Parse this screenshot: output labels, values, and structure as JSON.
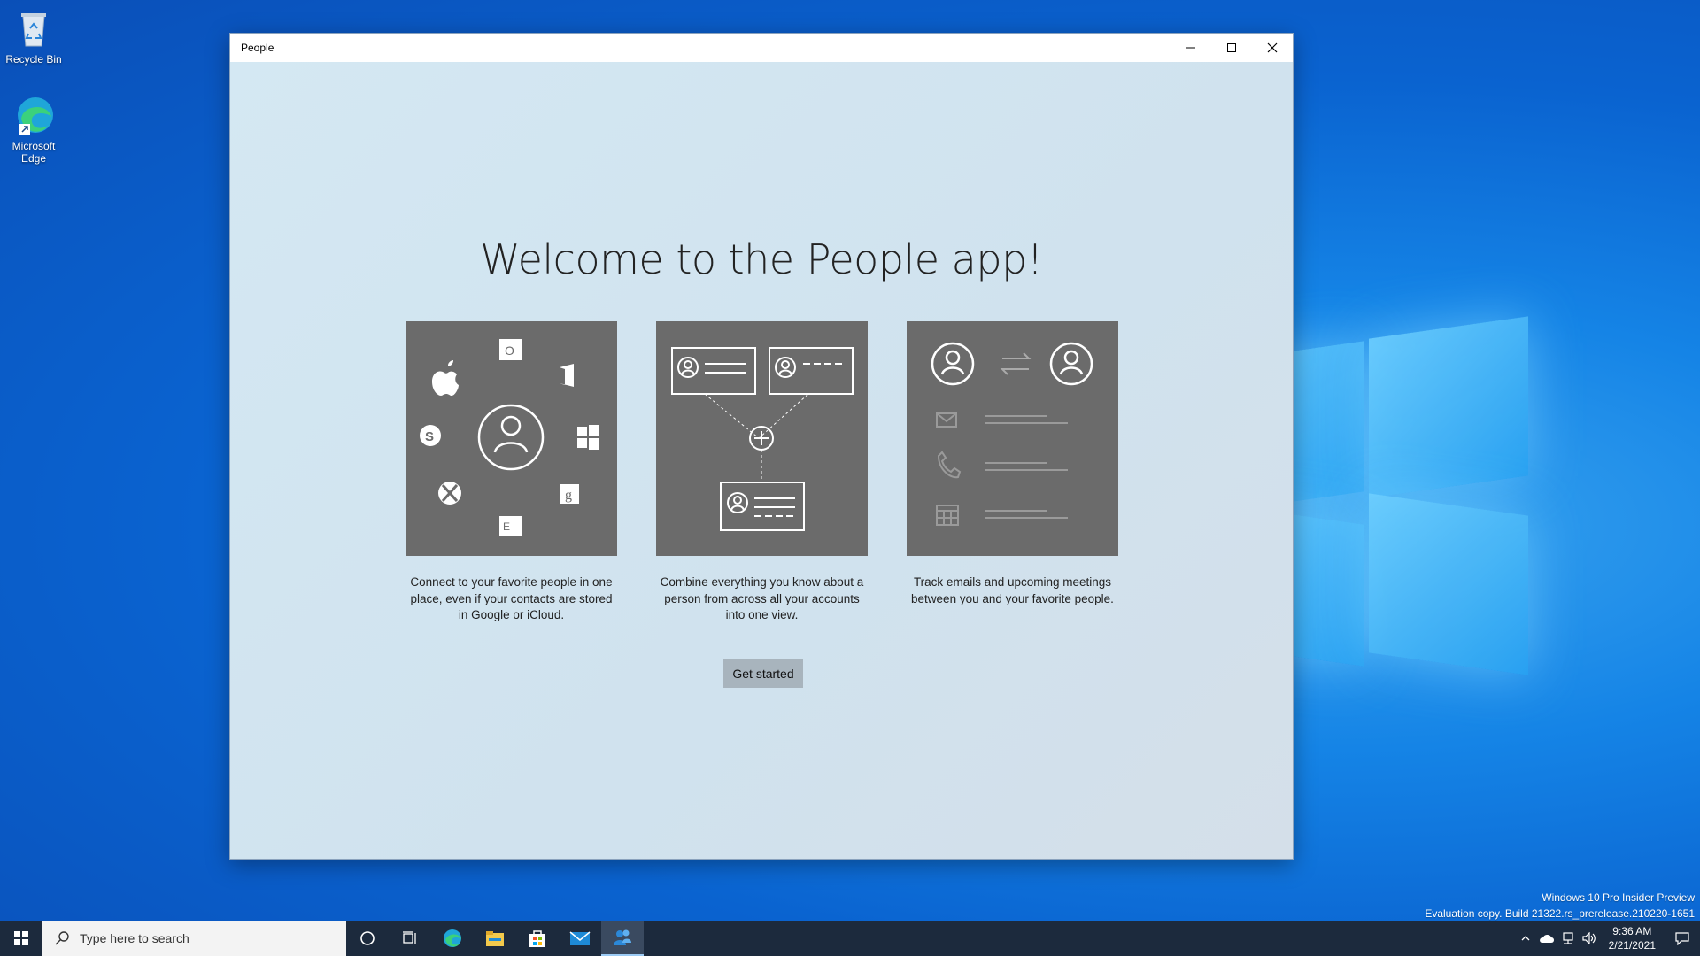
{
  "desktop": {
    "icons": [
      {
        "label": "Recycle Bin"
      },
      {
        "label": "Microsoft Edge"
      }
    ],
    "watermark": {
      "line1": "Windows 10 Pro Insider Preview",
      "line2": "Evaluation copy. Build 21322.rs_prerelease.210220-1651"
    }
  },
  "window": {
    "title": "People",
    "heading": "Welcome to the People app!",
    "cards": [
      {
        "text": "Connect to your favorite people in one place, even if your contacts are stored in Google or iCloud."
      },
      {
        "text": "Combine everything you know about a person from across all your accounts into one view."
      },
      {
        "text": "Track emails and upcoming meetings between you and your favorite people."
      }
    ],
    "button": "Get started"
  },
  "taskbar": {
    "search_placeholder": "Type here to search",
    "time": "9:36 AM",
    "date": "2/21/2021",
    "pinned": [
      "cortana-icon",
      "task-view-icon",
      "edge-icon",
      "file-explorer-icon",
      "store-icon",
      "mail-icon",
      "people-icon"
    ]
  },
  "colors": {
    "desktop": "#0a63d0",
    "card": "#6b6b6b",
    "taskbar": "#1c2a3d",
    "button": "#a8b4bd"
  }
}
